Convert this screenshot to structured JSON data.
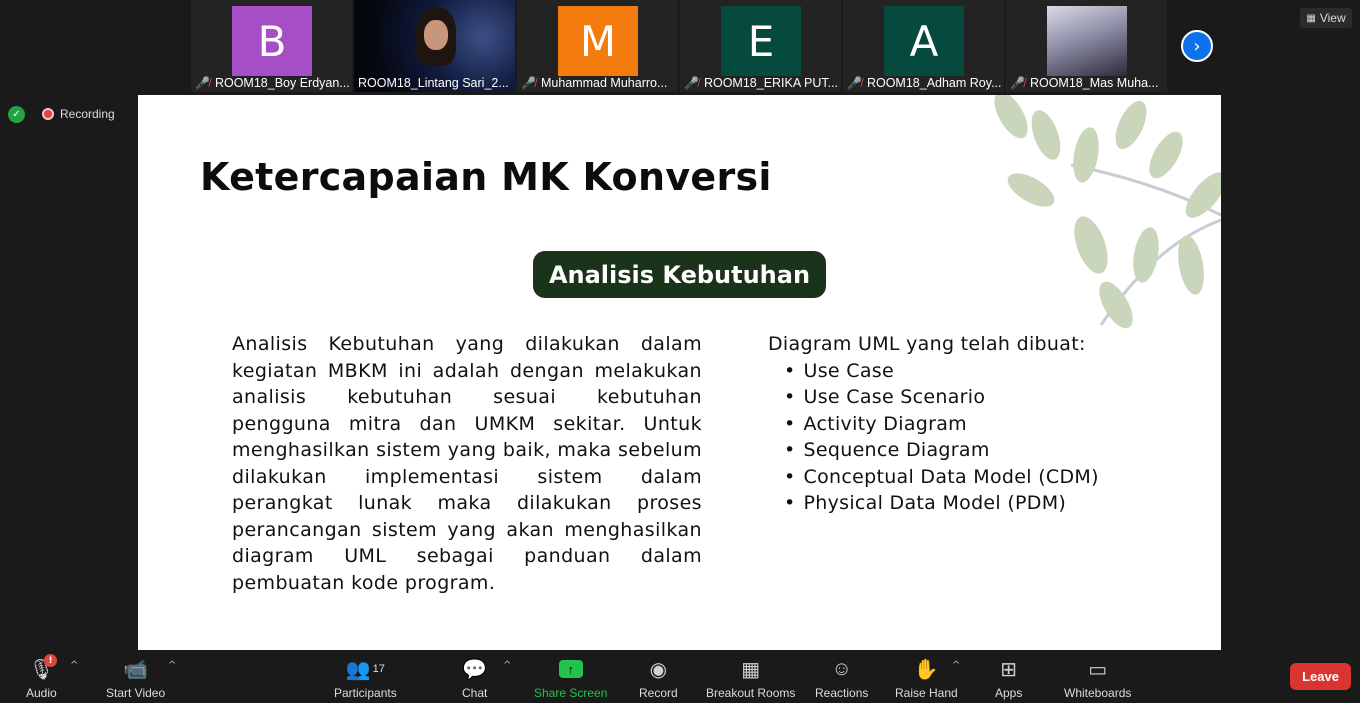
{
  "participants": [
    {
      "initial": "B",
      "name": "ROOM18_Boy Erdyan...",
      "color": "#a64ec5",
      "muted": true,
      "type": "initial"
    },
    {
      "initial": "",
      "name": "ROOM18_Lintang Sari_2...",
      "color": "",
      "muted": false,
      "type": "video"
    },
    {
      "initial": "M",
      "name": "Muhammad Muharro...",
      "color": "#f37a0c",
      "muted": true,
      "type": "initial"
    },
    {
      "initial": "E",
      "name": "ROOM18_ERIKA PUT...",
      "color": "#054a3c",
      "muted": true,
      "type": "initial"
    },
    {
      "initial": "A",
      "name": "ROOM18_Adham Roy...",
      "color": "#054a3c",
      "muted": true,
      "type": "initial"
    },
    {
      "initial": "",
      "name": "ROOM18_Mas Muha...",
      "color": "",
      "muted": true,
      "type": "image"
    }
  ],
  "top": {
    "view_label": "View",
    "next_icon": "chevron-right-icon"
  },
  "status": {
    "recording_label": "Recording",
    "security_icon": "shield-check-icon"
  },
  "slide": {
    "title": "Ketercapaian MK Konversi",
    "pill": "Analisis Kebutuhan",
    "paragraph": "Analisis Kebutuhan yang dilakukan dalam kegiatan MBKM ini adalah dengan melakukan analisis kebutuhan sesuai kebutuhan pengguna mitra dan UMKM sekitar. Untuk menghasilkan sistem yang baik, maka sebelum dilakukan implementasi sistem dalam perangkat lunak maka dilakukan proses perancangan sistem yang akan menghasilkan diagram UML sebagai panduan dalam pembuatan kode program.",
    "list_heading": "Diagram UML yang telah dibuat:",
    "list_items": [
      "Use Case",
      "Use Case Scenario",
      "Activity Diagram",
      "Sequence Diagram",
      "Conceptual Data Model (CDM)",
      "Physical Data Model (PDM)"
    ]
  },
  "toolbar": {
    "audio": "Audio",
    "audio_badge": "!",
    "video": "Start Video",
    "participants": "Participants",
    "participants_count": "17",
    "chat": "Chat",
    "share": "Share Screen",
    "record": "Record",
    "breakout": "Breakout Rooms",
    "reactions": "Reactions",
    "raise_hand": "Raise Hand",
    "apps": "Apps",
    "whiteboards": "Whiteboards",
    "leave": "Leave"
  },
  "colors": {
    "share_green": "#23c24c",
    "leave_red": "#d9342f",
    "pill_green": "#1b3319",
    "accent_blue": "#0e72ed"
  }
}
